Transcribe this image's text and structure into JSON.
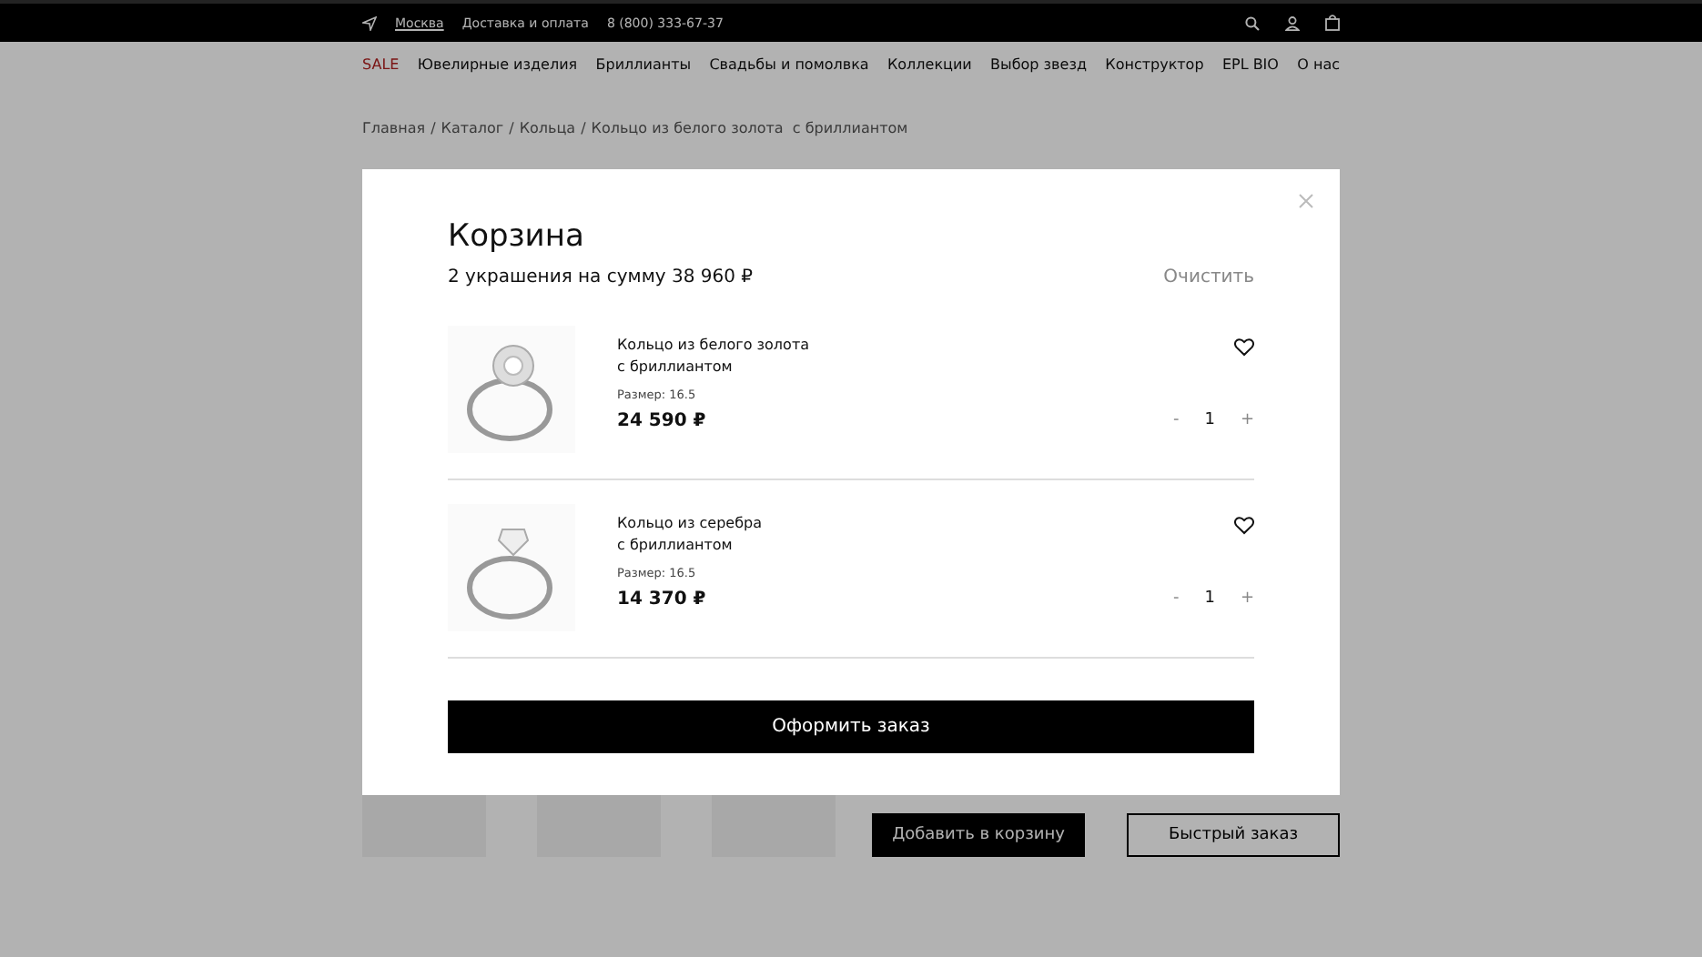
{
  "top_bar": {
    "city": "Москва",
    "delivery": "Доставка и оплата",
    "phone": "8 (800) 333-67-37"
  },
  "nav": [
    {
      "label": "SALE",
      "kind": "sale"
    },
    {
      "label": "Ювелирные изделия",
      "kind": "normal"
    },
    {
      "label": "Бриллианты",
      "kind": "normal"
    },
    {
      "label": "Свадьбы и помолвка",
      "kind": "normal"
    },
    {
      "label": "Коллекции",
      "kind": "normal"
    },
    {
      "label": "Выбор звезд",
      "kind": "normal"
    },
    {
      "label": "Конструктор",
      "kind": "normal"
    },
    {
      "label": "EPL BIO",
      "kind": "normal"
    },
    {
      "label": "О нас",
      "kind": "normal"
    }
  ],
  "breadcrumb": {
    "separator": "/",
    "items": [
      "Главная",
      "Каталог",
      "Кольца",
      "Кольцо из белого золота  с бриллиантом"
    ]
  },
  "product": {
    "buttons": [
      {
        "label": "Добавить в корзину",
        "kind": "primary"
      },
      {
        "label": "Быстрый заказ",
        "kind": "outline"
      }
    ]
  },
  "cart_modal": {
    "title": "Корзина",
    "summary": "2 украшения на сумму 38 960 ₽",
    "clear": "Очистить",
    "items": [
      {
        "name_lines": [
          "Кольцо из белого золота",
          "с бриллиантом"
        ],
        "size": "Размер: 16.5",
        "price": "24 590 ₽",
        "minus": "-",
        "quantity": "1",
        "plus": "+",
        "kind": "cluster"
      },
      {
        "name_lines": [
          "Кольцо из серебра",
          "с бриллиантом"
        ],
        "size": "Размер: 16.5",
        "price": "14 370 ₽",
        "minus": "-",
        "quantity": "1",
        "plus": "+",
        "kind": "solitaire"
      }
    ],
    "checkout": "Оформить заказ"
  }
}
